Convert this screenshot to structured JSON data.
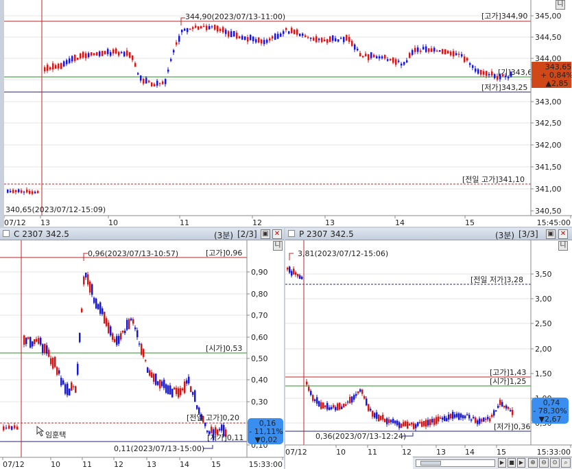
{
  "colors": {
    "up": "#d01818",
    "down": "#1818d0",
    "high_line": "#c02020",
    "open_line": "#209020",
    "low_line": "#202080",
    "badge_up": "#d04818",
    "badge_down": "#3a8ef0"
  },
  "main": {
    "high_label": "344,90(2023/07/13-11:00)",
    "low_label": "340,65(2023/07/12-15:09)",
    "tag_high": "[고가]344,90",
    "tag_x": "[기]343,60",
    "tag_low": "[저가]343,25",
    "tag_prev_high": "[전일 고가]341,10",
    "badge": {
      "price": "343,65",
      "pct": "+ 0,84%",
      "chg": "▲2,85"
    },
    "icon_label": "니",
    "y_ticks": [
      "345,00",
      "344,50",
      "344,00",
      "343,50",
      "343,00",
      "342,50",
      "342,00",
      "341,50",
      "341,00",
      "340,50"
    ],
    "x_ticks": [
      "07/12",
      "13",
      "10",
      "11",
      "12",
      "13",
      "14",
      "15",
      "15:45:00"
    ]
  },
  "call": {
    "title": "C 2307 342.5",
    "interval": "(3분)",
    "page": "[2/3]",
    "high_label": "0,96(2023/07/13-10:57)",
    "low_label": "0,11(2023/07/13-15:00)",
    "tag_high": "[고가]0,96",
    "tag_open": "[시가]0,53",
    "tag_prev_high": "[전일 고가]0,20",
    "tag_low": "[저가]0,11",
    "badge": {
      "price": "0,16",
      "pct": "- 11,11%",
      "chg": "▼0,02"
    },
    "watermark": "임훈택",
    "icon_label": "니",
    "y_ticks": [
      "0,90",
      "0,80",
      "0,70",
      "0,60",
      "0,50",
      "0,40",
      "0,30",
      "0,20",
      "0,10"
    ],
    "x_ticks": [
      "07/12",
      "10",
      "11",
      "12",
      "13",
      "14",
      "15",
      "15:33:00"
    ]
  },
  "put": {
    "title": "P 2307 342.5",
    "interval": "(3분)",
    "page": "[3/3]",
    "high_label": "3,81(2023/07/12-15:06)",
    "low_label": "0,36(2023/07/13-12:24)",
    "tag_prev_low": "[전일 저가]3,28",
    "tag_high": "[고가]1,43",
    "tag_open": "[시가]1,25",
    "tag_low": "[저가]0,36",
    "badge": {
      "price": "0,74",
      "pct": "- 78,30%",
      "chg": "▼2,67"
    },
    "icon_label": "니",
    "y_ticks": [
      "3,50",
      "3,00",
      "2,50",
      "2,00",
      "1,50",
      "1,00",
      "0,50"
    ],
    "x_ticks": [
      "07/12",
      "10",
      "11",
      "12",
      "13",
      "14",
      "15",
      "15:33:00"
    ]
  }
}
